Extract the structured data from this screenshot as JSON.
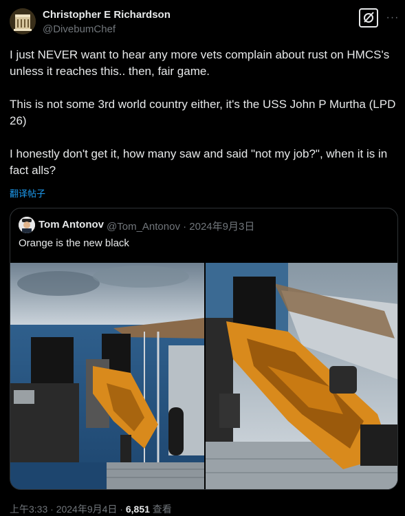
{
  "author": {
    "display_name": "Christopher E Richardson",
    "handle": "@DivebumChef",
    "avatar_icon": "restaurant-building-avatar"
  },
  "actions": {
    "grok_icon": "slash-square-icon",
    "more_label": "···"
  },
  "tweet": {
    "paragraphs": [
      "I just NEVER want to hear any more vets complain about rust on HMCS's unless it reaches this.. then, fair game.",
      "This is not some 3rd world country either, it's the USS John P Murtha (LPD 26)",
      "I honestly don't get it, how many saw and said \"not my job?\", when it is in fact alls?"
    ],
    "translate_label": "翻译帖子"
  },
  "quote": {
    "display_name": "Tom Antonov",
    "handle_date": "@Tom_Antonov · 2024年9月3日",
    "text": "Orange is the new black",
    "avatar_icon": "sailor-portrait-avatar",
    "photos": [
      {
        "description_icon": "rusty-machine-gun-photo"
      },
      {
        "description_icon": "rusty-machine-gun-closeup-photo"
      }
    ]
  },
  "footer": {
    "time_date": "上午3:33 · 2024年9月4日 · ",
    "views": "6,851",
    "views_label": " 查看"
  },
  "colors": {
    "background": "#000000",
    "text": "#e7e9ea",
    "secondary": "#71767b",
    "link": "#1d9bf0",
    "border": "#2f3336",
    "rust_orange": "#d98a1c"
  }
}
